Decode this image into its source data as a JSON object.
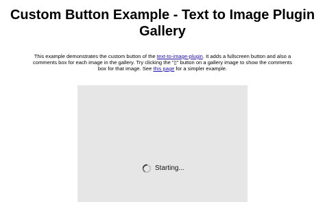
{
  "page": {
    "title": "Custom Button Example - Text to Image Plugin Gallery"
  },
  "description": {
    "part1": "This example demonstrates the custom button of the ",
    "link1_text": "text-to-image-plugin",
    "part2": ". It adds a fullscreen button and also a comments box for each image in the gallery. Try clicking the \"▯\" button on a gallery image to show the comments box for that image. See ",
    "link2_text": "this page",
    "part3": " for a simpler example."
  },
  "gallery": {
    "status_text": "Starting...",
    "background_color": "#e6e6e6",
    "spinner_icon": "loading-spinner-icon"
  },
  "colors": {
    "link": "#1a0dab"
  }
}
